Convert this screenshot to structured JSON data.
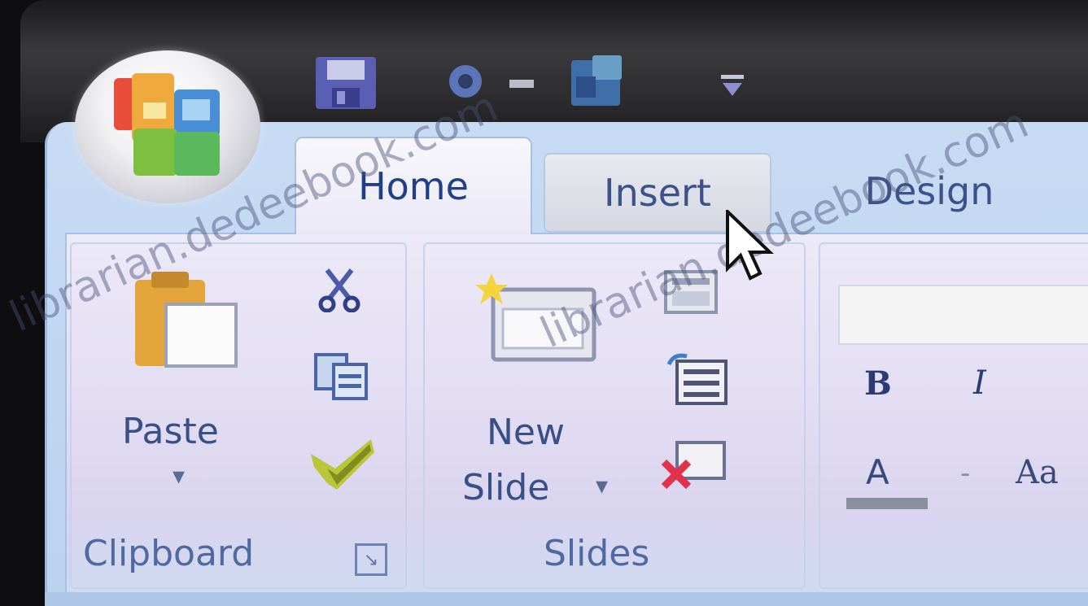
{
  "tabs": [
    {
      "label": "Home",
      "active": true
    },
    {
      "label": "Insert",
      "active": false
    },
    {
      "label": "Design",
      "active": false
    }
  ],
  "clipboard": {
    "paste_label": "Paste",
    "paste_arrow": "▾",
    "group_label": "Clipboard",
    "launcher_glyph": "↘"
  },
  "slides": {
    "new_slide_line1": "New",
    "new_slide_line2": "Slide",
    "new_slide_arrow": "▾",
    "group_label": "Slides"
  },
  "font": {
    "bold_glyph": "B",
    "italic_glyph": "I",
    "font_color_glyph": "A",
    "change_case_glyph": "Aa",
    "separator": "-"
  },
  "watermark": {
    "text1": "librarian.dedeebook.com",
    "text2": "librarian.dedeebook.com"
  },
  "icons": {
    "office_button": "office-orb-icon",
    "save": "save-icon",
    "undo": "undo-icon",
    "redo": "redo-icon",
    "customize": "customize-qat-icon",
    "cut": "scissors-icon",
    "copy": "copy-icon",
    "format_painter": "format-painter-icon",
    "layout": "layout-icon",
    "reset": "reset-icon",
    "delete": "delete-slide-icon"
  },
  "colors": {
    "tab_text": "#213f86",
    "group_label": "#4f6aa0",
    "ribbon_bg": "#c7dbf3",
    "panel_bg": "#e6e2f6"
  }
}
